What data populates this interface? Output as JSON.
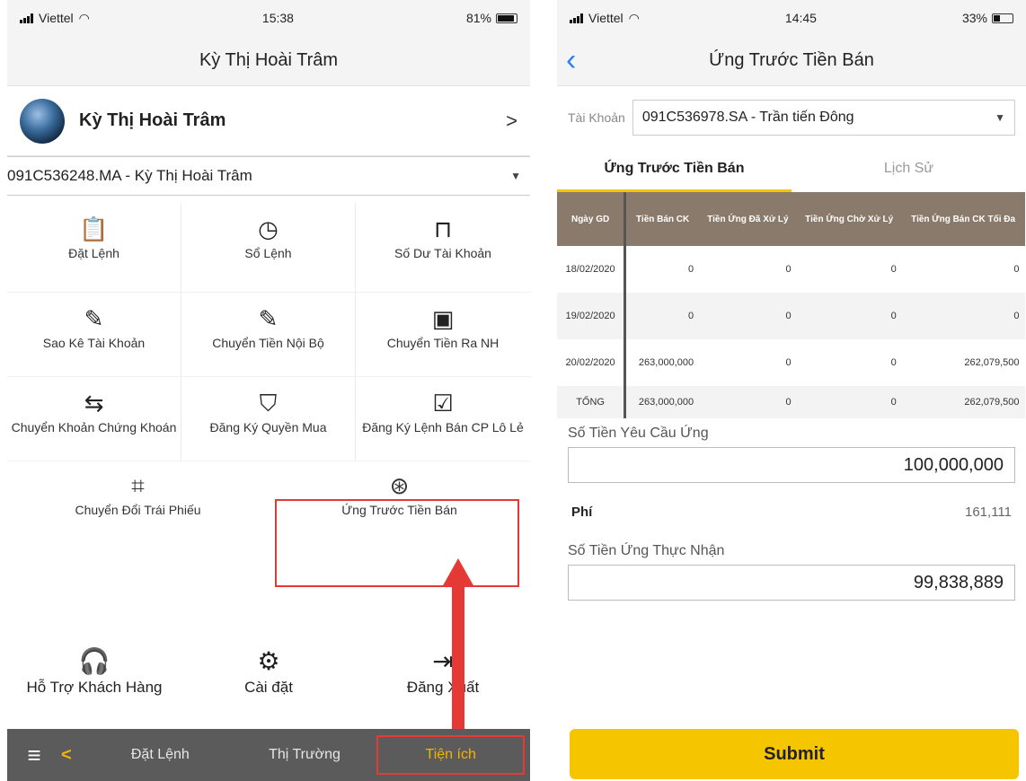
{
  "left": {
    "status": {
      "carrier": "Viettel",
      "time": "15:38",
      "battery": "81%",
      "battery_level": 0.81
    },
    "nav_title": "Kỳ Thị Hoài Trâm",
    "profile_name": "Kỳ Thị Hoài Trâm",
    "account": "091C536248.MA - Kỳ Thị Hoài Trâm",
    "menu": [
      {
        "label": "Đặt Lệnh",
        "icon": "clipboard-check-icon"
      },
      {
        "label": "Sổ Lệnh",
        "icon": "clock-icon"
      },
      {
        "label": "Số Dư Tài Khoản",
        "icon": "shopping-bag-icon"
      },
      {
        "label": "Sao Kê Tài Khoản",
        "icon": "edit-icon"
      },
      {
        "label": "Chuyển Tiền Nội Bộ",
        "icon": "edit-icon"
      },
      {
        "label": "Chuyển Tiền Ra NH",
        "icon": "wallet-icon"
      },
      {
        "label": "Chuyển Khoản Chứng Khoán",
        "icon": "transfer-icon"
      },
      {
        "label": "Đăng Ký Quyền Mua",
        "icon": "shield-check-icon"
      },
      {
        "label": "Đăng Ký Lệnh Bán CP Lô Lẻ",
        "icon": "clipboard-check-icon"
      }
    ],
    "wide_menu": [
      {
        "label": "Chuyển Đổi Trái Phiếu",
        "icon": "crop-icon"
      },
      {
        "label": "Ứng Trước Tiền Bán",
        "icon": "lifebuoy-icon"
      }
    ],
    "bottom": [
      {
        "label": "Hỗ Trợ Khách Hàng",
        "icon": "headset-icon"
      },
      {
        "label": "Cài đặt",
        "icon": "gear-icon"
      },
      {
        "label": "Đăng Xuất",
        "icon": "logout-icon"
      }
    ],
    "tabs": {
      "order": "Đặt Lệnh",
      "market": "Thị Trường",
      "utilities": "Tiện ích"
    }
  },
  "right": {
    "status": {
      "carrier": "Viettel",
      "time": "14:45",
      "battery": "33%",
      "battery_level": 0.33
    },
    "nav_title": "Ứng Trước Tiền Bán",
    "account_label": "Tài Khoản",
    "account": "091C536978.SA - Trần tiến Đông",
    "subtabs": {
      "advance": "Ứng Trước Tiền Bán",
      "history": "Lịch Sử"
    },
    "table": {
      "headers": [
        "Ngày GD",
        "Tiền Bán CK",
        "Tiền Ứng Đã Xử Lý",
        "Tiền Ứng Chờ Xử Lý",
        "Tiền Ứng Bán CK Tối Đa"
      ],
      "rows": [
        [
          "18/02/2020",
          "0",
          "0",
          "0",
          "0"
        ],
        [
          "19/02/2020",
          "0",
          "0",
          "0",
          "0"
        ],
        [
          "20/02/2020",
          "263,000,000",
          "0",
          "0",
          "262,079,500"
        ]
      ],
      "total": [
        "TỔNG",
        "263,000,000",
        "0",
        "0",
        "262,079,500"
      ]
    },
    "request_label": "Số Tiền Yêu Cầu Ứng",
    "request_value": "100,000,000",
    "fee_label": "Phí",
    "fee_value": "161,111",
    "received_label": "Số Tiền Ứng Thực Nhận",
    "received_value": "99,838,889",
    "submit": "Submit"
  }
}
